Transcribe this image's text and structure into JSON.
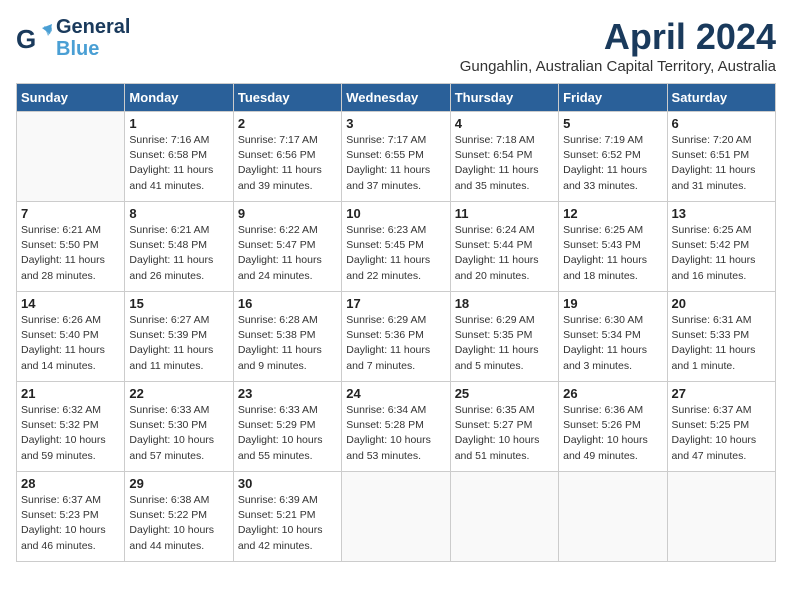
{
  "logo": {
    "line1": "General",
    "line2": "Blue"
  },
  "title": "April 2024",
  "subtitle": "Gungahlin, Australian Capital Territory, Australia",
  "weekdays": [
    "Sunday",
    "Monday",
    "Tuesday",
    "Wednesday",
    "Thursday",
    "Friday",
    "Saturday"
  ],
  "weeks": [
    [
      {
        "day": "",
        "info": ""
      },
      {
        "day": "1",
        "info": "Sunrise: 7:16 AM\nSunset: 6:58 PM\nDaylight: 11 hours\nand 41 minutes."
      },
      {
        "day": "2",
        "info": "Sunrise: 7:17 AM\nSunset: 6:56 PM\nDaylight: 11 hours\nand 39 minutes."
      },
      {
        "day": "3",
        "info": "Sunrise: 7:17 AM\nSunset: 6:55 PM\nDaylight: 11 hours\nand 37 minutes."
      },
      {
        "day": "4",
        "info": "Sunrise: 7:18 AM\nSunset: 6:54 PM\nDaylight: 11 hours\nand 35 minutes."
      },
      {
        "day": "5",
        "info": "Sunrise: 7:19 AM\nSunset: 6:52 PM\nDaylight: 11 hours\nand 33 minutes."
      },
      {
        "day": "6",
        "info": "Sunrise: 7:20 AM\nSunset: 6:51 PM\nDaylight: 11 hours\nand 31 minutes."
      }
    ],
    [
      {
        "day": "7",
        "info": "Sunrise: 6:21 AM\nSunset: 5:50 PM\nDaylight: 11 hours\nand 28 minutes."
      },
      {
        "day": "8",
        "info": "Sunrise: 6:21 AM\nSunset: 5:48 PM\nDaylight: 11 hours\nand 26 minutes."
      },
      {
        "day": "9",
        "info": "Sunrise: 6:22 AM\nSunset: 5:47 PM\nDaylight: 11 hours\nand 24 minutes."
      },
      {
        "day": "10",
        "info": "Sunrise: 6:23 AM\nSunset: 5:45 PM\nDaylight: 11 hours\nand 22 minutes."
      },
      {
        "day": "11",
        "info": "Sunrise: 6:24 AM\nSunset: 5:44 PM\nDaylight: 11 hours\nand 20 minutes."
      },
      {
        "day": "12",
        "info": "Sunrise: 6:25 AM\nSunset: 5:43 PM\nDaylight: 11 hours\nand 18 minutes."
      },
      {
        "day": "13",
        "info": "Sunrise: 6:25 AM\nSunset: 5:42 PM\nDaylight: 11 hours\nand 16 minutes."
      }
    ],
    [
      {
        "day": "14",
        "info": "Sunrise: 6:26 AM\nSunset: 5:40 PM\nDaylight: 11 hours\nand 14 minutes."
      },
      {
        "day": "15",
        "info": "Sunrise: 6:27 AM\nSunset: 5:39 PM\nDaylight: 11 hours\nand 11 minutes."
      },
      {
        "day": "16",
        "info": "Sunrise: 6:28 AM\nSunset: 5:38 PM\nDaylight: 11 hours\nand 9 minutes."
      },
      {
        "day": "17",
        "info": "Sunrise: 6:29 AM\nSunset: 5:36 PM\nDaylight: 11 hours\nand 7 minutes."
      },
      {
        "day": "18",
        "info": "Sunrise: 6:29 AM\nSunset: 5:35 PM\nDaylight: 11 hours\nand 5 minutes."
      },
      {
        "day": "19",
        "info": "Sunrise: 6:30 AM\nSunset: 5:34 PM\nDaylight: 11 hours\nand 3 minutes."
      },
      {
        "day": "20",
        "info": "Sunrise: 6:31 AM\nSunset: 5:33 PM\nDaylight: 11 hours\nand 1 minute."
      }
    ],
    [
      {
        "day": "21",
        "info": "Sunrise: 6:32 AM\nSunset: 5:32 PM\nDaylight: 10 hours\nand 59 minutes."
      },
      {
        "day": "22",
        "info": "Sunrise: 6:33 AM\nSunset: 5:30 PM\nDaylight: 10 hours\nand 57 minutes."
      },
      {
        "day": "23",
        "info": "Sunrise: 6:33 AM\nSunset: 5:29 PM\nDaylight: 10 hours\nand 55 minutes."
      },
      {
        "day": "24",
        "info": "Sunrise: 6:34 AM\nSunset: 5:28 PM\nDaylight: 10 hours\nand 53 minutes."
      },
      {
        "day": "25",
        "info": "Sunrise: 6:35 AM\nSunset: 5:27 PM\nDaylight: 10 hours\nand 51 minutes."
      },
      {
        "day": "26",
        "info": "Sunrise: 6:36 AM\nSunset: 5:26 PM\nDaylight: 10 hours\nand 49 minutes."
      },
      {
        "day": "27",
        "info": "Sunrise: 6:37 AM\nSunset: 5:25 PM\nDaylight: 10 hours\nand 47 minutes."
      }
    ],
    [
      {
        "day": "28",
        "info": "Sunrise: 6:37 AM\nSunset: 5:23 PM\nDaylight: 10 hours\nand 46 minutes."
      },
      {
        "day": "29",
        "info": "Sunrise: 6:38 AM\nSunset: 5:22 PM\nDaylight: 10 hours\nand 44 minutes."
      },
      {
        "day": "30",
        "info": "Sunrise: 6:39 AM\nSunset: 5:21 PM\nDaylight: 10 hours\nand 42 minutes."
      },
      {
        "day": "",
        "info": ""
      },
      {
        "day": "",
        "info": ""
      },
      {
        "day": "",
        "info": ""
      },
      {
        "day": "",
        "info": ""
      }
    ]
  ]
}
